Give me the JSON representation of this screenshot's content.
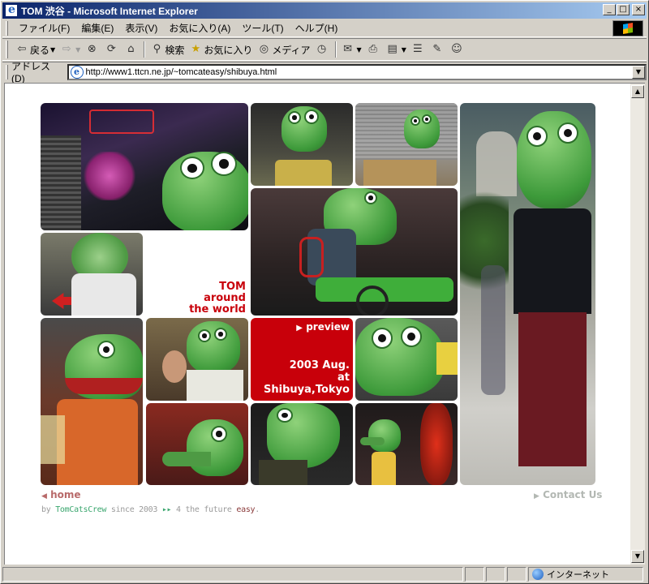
{
  "window": {
    "title": "TOM 渋谷 - Microsoft Internet Explorer",
    "buttons": {
      "minimize": "_",
      "maximize": "□",
      "close": "×"
    }
  },
  "menu": [
    "ファイル(F)",
    "編集(E)",
    "表示(V)",
    "お気に入り(A)",
    "ツール(T)",
    "ヘルプ(H)"
  ],
  "toolbar": {
    "back": "戻る",
    "search": "検索",
    "favorites": "お気に入り",
    "media": "メディア",
    "icons": [
      "back-arrow-icon",
      "forward-arrow-icon",
      "stop-icon",
      "refresh-icon",
      "home-icon",
      "search-icon",
      "favorites-icon",
      "media-icon",
      "history-icon",
      "mail-icon",
      "print-icon",
      "edit-icon",
      "discuss-icon",
      "messenger-icon"
    ]
  },
  "address": {
    "label": "アドレス(D)",
    "url": "http://www1.ttcn.ne.jp/~tomcateasy/shibuya.html"
  },
  "page": {
    "tom_caption": [
      "TOM",
      "around",
      "the world"
    ],
    "preview_link": "preview",
    "preview_date": [
      "2003 Aug.",
      "at Shibuya,Tokyo"
    ],
    "home_link": "home",
    "contact_link": "Contact Us",
    "footer": {
      "by": "by",
      "crew": "TomCatsCrew",
      "since": "since 2003",
      "arrows": "▸▸",
      "future": "4 the future",
      "easy": "easy",
      "dot": "."
    },
    "colors": {
      "accent_red": "#c8000a",
      "croc_green": "#3d9a3a",
      "home_link": "#b86a6a",
      "crew_green": "#3aa66e"
    }
  },
  "status": {
    "zone": "インターネット"
  }
}
